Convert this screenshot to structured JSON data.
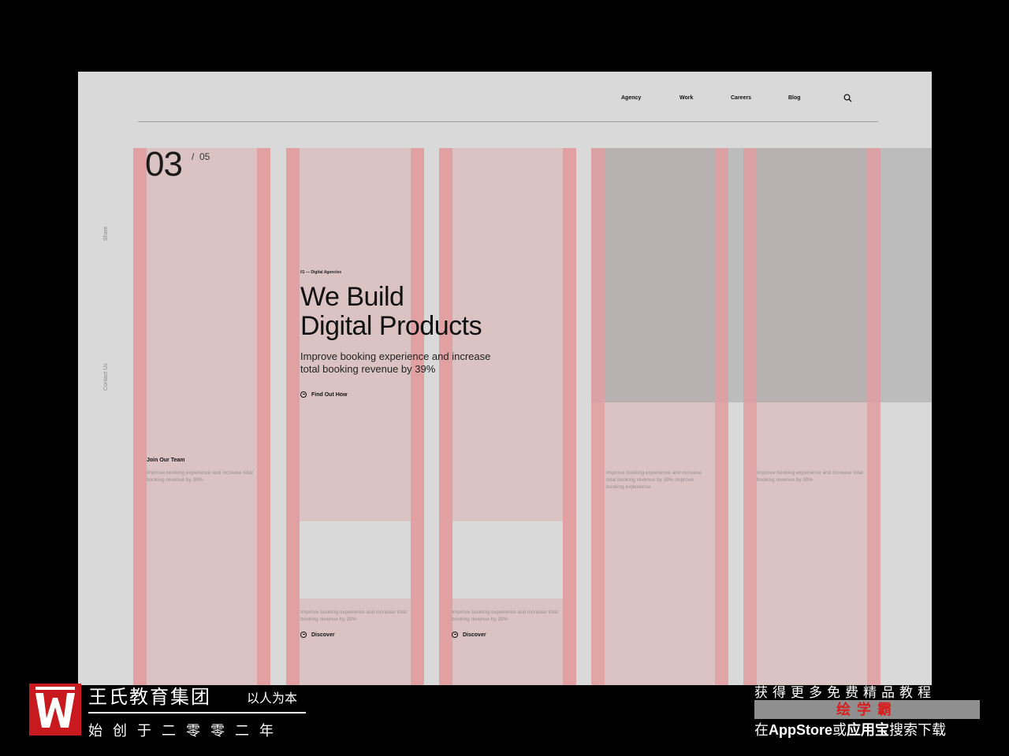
{
  "nav": {
    "items": [
      "Agency",
      "Work",
      "Careers",
      "Blog"
    ],
    "search_icon": "search-icon"
  },
  "sidebar": {
    "share": "Share",
    "contact": "Contact Us"
  },
  "slider": {
    "current": "03",
    "separator": "/",
    "total": "05"
  },
  "hero": {
    "eyebrow": "01 — Digital Agencies",
    "headline_line1": "We Build",
    "headline_line2": "Digital Products",
    "subhead": "Improve booking experience and increase total booking revenue by 39%",
    "cta": "Find Out How",
    "cta_icon": "arrow-circle-icon"
  },
  "team": {
    "title": "Join Our Team",
    "text": "Improve booking experience and increase total booking revenue by 39%"
  },
  "cards": [
    {
      "text": "Improve booking experience and increase total booking revenue by 39%",
      "cta": "Discover"
    },
    {
      "text": "Improve booking experience and increase total booking revenue by 39%",
      "cta": "Discover"
    }
  ],
  "features": [
    {
      "text": "Improve booking experience and increase total booking revenue by 39% Improve booking experience"
    },
    {
      "text": "Improve booking experience and increase total booking revenue by 39%"
    }
  ],
  "branding": {
    "company": "王氏教育集团",
    "slogan": "以人为本",
    "since": "始创于二零零二年",
    "promo_line1": "获得更多免费精品教程",
    "promo_badge": "绘学霸",
    "promo_pre": "在",
    "promo_app": "AppStore",
    "promo_or": "或",
    "promo_store": "应用宝",
    "promo_post": "搜索下载"
  },
  "colors": {
    "canvas": "#d9d9d9",
    "column_fill": "#dbc3c4",
    "gutter": "#e1a0a2",
    "brand_red": "#c8191f"
  }
}
